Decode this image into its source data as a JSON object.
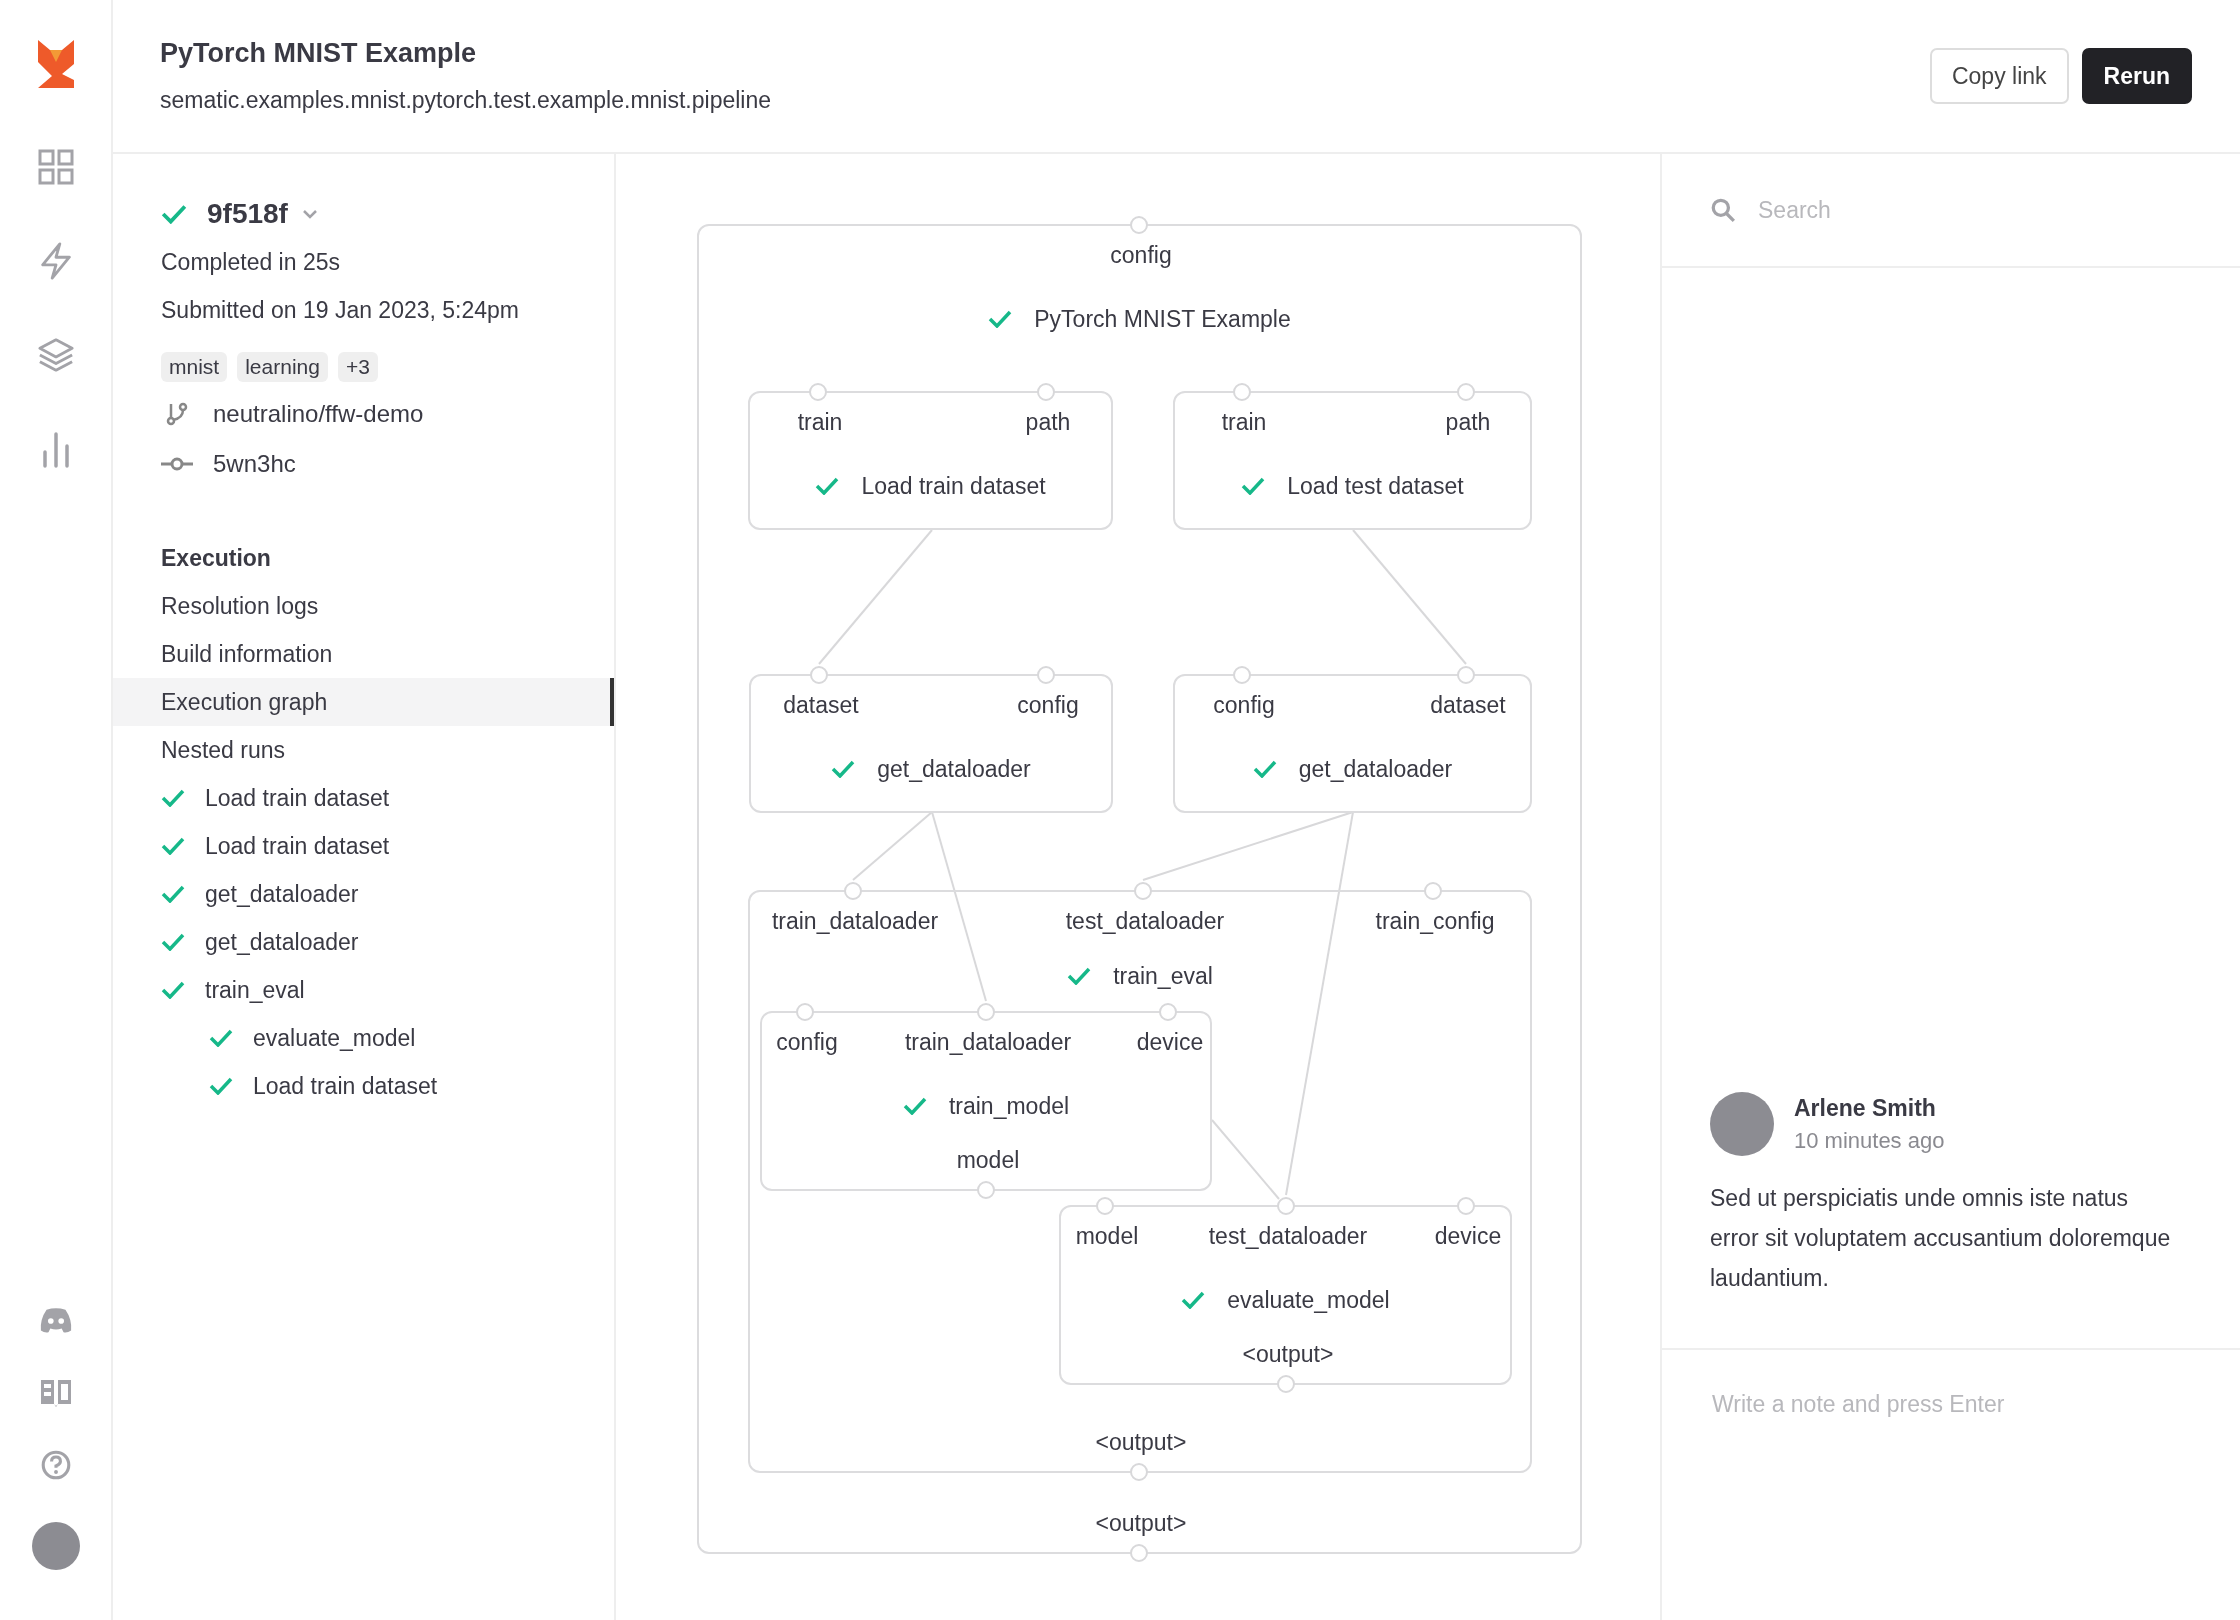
{
  "header": {
    "title": "PyTorch MNIST Example",
    "subtitle": "sematic.examples.mnist.pytorch.test.example.mnist.pipeline",
    "buttons": [
      {
        "label": "Copy link",
        "kind": "outline"
      },
      {
        "label": "Rerun",
        "kind": "primary"
      }
    ]
  },
  "run": {
    "completed": true,
    "id": "9f518f",
    "duration": "Completed in 25s",
    "submitted": "Submitted on 19 Jan 2023, 5:24pm",
    "tags": [
      "mnist",
      "learning",
      "+3"
    ],
    "repo": "neutralino/ffw-demo",
    "commit": "5wn3hc"
  },
  "nav": {
    "heading": "Execution",
    "items": [
      {
        "label": "Resolution logs",
        "selected": false
      },
      {
        "label": "Build information",
        "selected": false
      },
      {
        "label": "Execution graph",
        "selected": true
      },
      {
        "label": "Nested runs",
        "selected": false
      }
    ]
  },
  "nested_runs": [
    {
      "name": "Load train dataset",
      "completed": true
    },
    {
      "name": "Load train dataset",
      "completed": true
    },
    {
      "name": "get_dataloader",
      "completed": true
    },
    {
      "name": "get_dataloader",
      "completed": true
    },
    {
      "name": "train_eval",
      "completed": true,
      "children": [
        {
          "name": "evaluate_model",
          "completed": true
        },
        {
          "name": "Load train dataset",
          "completed": true
        }
      ]
    }
  ],
  "graph": {
    "name": "PyTorch MNIST Example",
    "completed": true,
    "inputs": [
      "config"
    ],
    "outputs": [
      "<output>"
    ],
    "children": [
      {
        "name": "Load train dataset",
        "completed": true,
        "inputs": [
          "train",
          "path"
        ]
      },
      {
        "name": "Load test dataset",
        "completed": true,
        "inputs": [
          "train",
          "path"
        ]
      },
      {
        "name": "get_dataloader",
        "completed": true,
        "inputs": [
          "dataset",
          "config"
        ]
      },
      {
        "name": "get_dataloader",
        "completed": true,
        "inputs": [
          "config",
          "dataset"
        ]
      },
      {
        "name": "train_eval",
        "completed": true,
        "inputs": [
          "train_dataloader",
          "test_dataloader",
          "train_config"
        ],
        "outputs": [
          "<output>"
        ],
        "children": [
          {
            "name": "train_model",
            "completed": true,
            "inputs": [
              "config",
              "train_dataloader",
              "device"
            ],
            "outputs": [
              "model"
            ]
          },
          {
            "name": "evaluate_model",
            "completed": true,
            "inputs": [
              "model",
              "test_dataloader",
              "device"
            ],
            "outputs": [
              "<output>"
            ]
          }
        ]
      }
    ]
  },
  "search": {
    "placeholder": "Search"
  },
  "comments": [
    {
      "author": "Arlene Smith",
      "time": "10 minutes ago",
      "text": "Sed ut perspiciatis unde omnis iste natus error sit voluptatem accusantium doloremque laudantium."
    }
  ],
  "note": {
    "placeholder": "Write a note and press Enter"
  }
}
